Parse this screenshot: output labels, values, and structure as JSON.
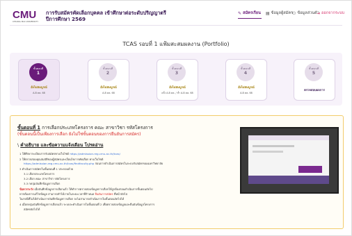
{
  "header": {
    "logo_text": "CMU",
    "logo_sub": "CHIANG MAI UNIVERSITY",
    "title_line1": "การรับสมัครคัดเลือกบุคคล เข้าศึกษาต่อระดับปริญญาตรี",
    "title_line2": "ปีการศึกษา 2569",
    "nav_apply": "สมัครเรียน",
    "nav_info": "ข้อมูลผู้สมัคร",
    "nav_user": "ข้อมูลส่วนตัว",
    "nav_logout": "ออกจากระบบ"
  },
  "page_title": "TCAS รอบที่ 1 แฟ้มสะสมผลงาน (Portfolio)",
  "steps": [
    {
      "label": "ขั้นตอนที่",
      "num": "1",
      "status": "ยังไม่สมบูรณ์",
      "dates": "A-B ตค. 68"
    },
    {
      "label": "ขั้นตอนที่",
      "num": "2",
      "status": "ยังไม่สมบูรณ์",
      "dates": "A-B ตค. 68"
    },
    {
      "label": "ขั้นตอนที่",
      "num": "3",
      "status": "ยังไม่สมบูรณ์",
      "dates": "ครั้ง A-B ตค. / ซ้ำ A-B ตค. 68"
    },
    {
      "label": "ขั้นตอนที่",
      "num": "4",
      "status": "ยังไม่สมบูรณ์",
      "dates": "A-B ตค. 68"
    },
    {
      "label": "ขั้นตอนที่",
      "num": "5",
      "status": "ตรวจสอบผลการ",
      "dates": ""
    }
  ],
  "content": {
    "step_heading": "ขั้นตอนที่ 1",
    "step_heading_rest": "การเลือกประเภทโครงการ คณะ สาขาวิชา รหัสโครงการ",
    "step_note": "(ขั้นตอนนี้เป็นเพียงการเลือก ยังไม่ใช่ขั้นตอนของการยืนยันการสมัคร)",
    "warn_heading": "คำอธิบาย และข้อความแจ้งเตือน โปรดอ่าน",
    "i1": "1 ให้ศึกษาระเบียบการรับสมัครทางเว็บไซต์",
    "i1_link": "https://admission.reg.cmu.ac.th/tcas/",
    "i2": "2 ให้ตรวจสอบคุณสมบัติของผู้สมัครและเงื่อนไขการคัดเลือก ทางเว็บไซต์",
    "i2_link": "https://admission.reg.cmu.ac.th/tcas/findfaculty.php",
    "i2_rest": "ก่อนการดำเนินการสมัครในระบบรับสมัครของมหาวิทยาลัย",
    "i3": "3 ดำเนินการสมัครในขั้นตอนที่ 1 ประกอบด้วย",
    "i31": "3.1 เลือกประเภทโครงการ",
    "i32": "3.2 เลือก คณะ สาขาวิชา รหัสโครงการ",
    "i33": "3.3 กดปุ่มบันทึกข้อมูลการเลือก",
    "i_warn": "ข้อควรระวัง",
    "i_warn_rest": "เมื่อบันทึกข้อมูลการเลือกแล้ว ให้ทำการตรวจสอบข้อมูลการเลือกให้ถูกต้องก่อนดำเนินการขั้นตอนถัดไป",
    "i_warn2a": "หากต้องการแก้ไขข้อมูล สามารถทำได้ภายในระยะเวลาที่กำหนด",
    "i_warn2_red": "ยืนยันการสมัคร",
    "i_warn2b": "ที่หน้าถัดไป",
    "i_warn3": "ในกรณีที่ไม่ได้ดำเนินการบันทึกข้อมูลการเลือก จะไม่สามารถดำเนินการในขั้นตอนถัดไปได้",
    "i4": "4 เมื่อกดปุ่มบันทึกข้อมูลการเลือกแล้ว ระบบจะดำเนินการในขั้นตอนที่ 2 เพื่อตรวจสอบข้อมูลและยืนยันข้อมูลโครงการ",
    "i4b": "สมัครต่อไปได้"
  },
  "colors": {
    "brand": "#6a1b7a",
    "warning": "#f2cc6a",
    "alert": "#d62828",
    "link": "#2f6bd8"
  }
}
